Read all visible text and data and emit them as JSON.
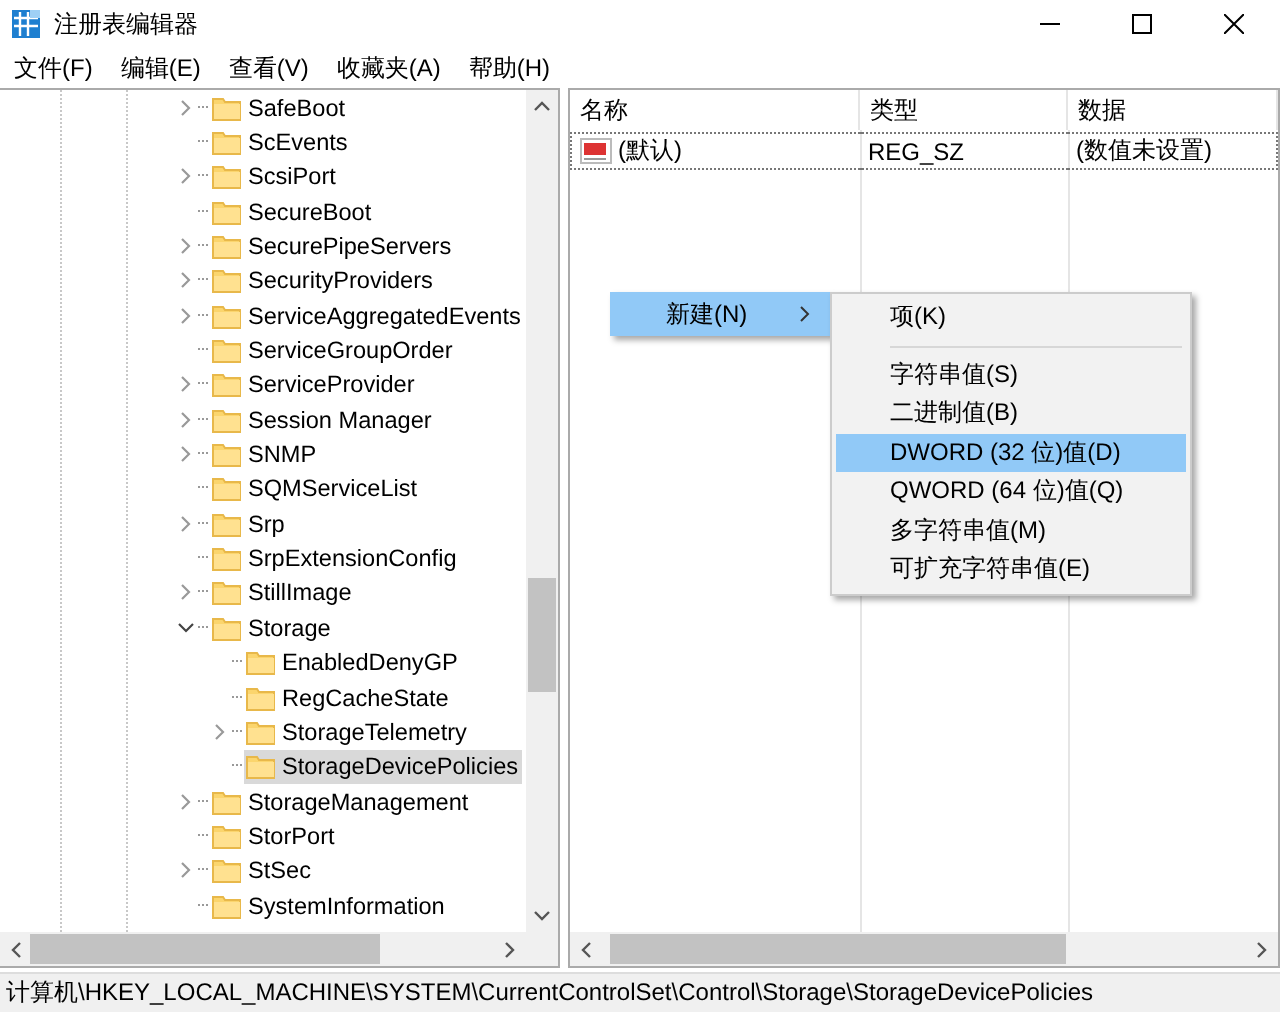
{
  "window": {
    "title": "注册表编辑器"
  },
  "menu": [
    {
      "label": "文件(F)"
    },
    {
      "label": "编辑(E)"
    },
    {
      "label": "查看(V)"
    },
    {
      "label": "收藏夹(A)"
    },
    {
      "label": "帮助(H)"
    }
  ],
  "tree": {
    "items": [
      {
        "kind": "branch",
        "label": "SafeBoot",
        "expanded": false,
        "selected": false
      },
      {
        "kind": "leaf",
        "label": "ScEvents",
        "selected": false
      },
      {
        "kind": "branch",
        "label": "ScsiPort",
        "expanded": false,
        "selected": false
      },
      {
        "kind": "leaf",
        "label": "SecureBoot",
        "selected": false
      },
      {
        "kind": "branch",
        "label": "SecurePipeServers",
        "expanded": false,
        "selected": false
      },
      {
        "kind": "branch",
        "label": "SecurityProviders",
        "expanded": false,
        "selected": false
      },
      {
        "kind": "branch",
        "label": "ServiceAggregatedEvents",
        "expanded": false,
        "selected": false
      },
      {
        "kind": "leaf",
        "label": "ServiceGroupOrder",
        "selected": false
      },
      {
        "kind": "branch",
        "label": "ServiceProvider",
        "expanded": false,
        "selected": false
      },
      {
        "kind": "branch",
        "label": "Session Manager",
        "expanded": false,
        "selected": false
      },
      {
        "kind": "branch",
        "label": "SNMP",
        "expanded": false,
        "selected": false
      },
      {
        "kind": "leaf",
        "label": "SQMServiceList",
        "selected": false
      },
      {
        "kind": "branch",
        "label": "Srp",
        "expanded": false,
        "selected": false
      },
      {
        "kind": "leaf",
        "label": "SrpExtensionConfig",
        "selected": false
      },
      {
        "kind": "branch",
        "label": "StillImage",
        "expanded": false,
        "selected": false
      },
      {
        "kind": "branch",
        "label": "Storage",
        "expanded": true,
        "selected": false,
        "children": [
          {
            "kind": "leaf",
            "label": "EnabledDenyGP",
            "selected": false
          },
          {
            "kind": "leaf",
            "label": "RegCacheState",
            "selected": false
          },
          {
            "kind": "branch",
            "label": "StorageTelemetry",
            "expanded": false,
            "selected": false
          },
          {
            "kind": "leaf",
            "label": "StorageDevicePolicies",
            "selected": true
          }
        ]
      },
      {
        "kind": "branch",
        "label": "StorageManagement",
        "expanded": false,
        "selected": false
      },
      {
        "kind": "leaf",
        "label": "StorPort",
        "selected": false
      },
      {
        "kind": "branch",
        "label": "StSec",
        "expanded": false,
        "selected": false
      },
      {
        "kind": "leaf",
        "label": "SystemInformation",
        "selected": false
      }
    ]
  },
  "values": {
    "columns": [
      "名称",
      "类型",
      "数据"
    ],
    "rows": [
      {
        "name": "(默认)",
        "type": "REG_SZ",
        "data": "(数值未设置)"
      }
    ]
  },
  "context_menu": {
    "items": [
      {
        "label": "新建(N)",
        "has_submenu": true,
        "selected": true
      }
    ],
    "submenu": [
      {
        "kind": "item",
        "label": "项(K)",
        "selected": false
      },
      {
        "kind": "separator"
      },
      {
        "kind": "item",
        "label": "字符串值(S)",
        "selected": false
      },
      {
        "kind": "item",
        "label": "二进制值(B)",
        "selected": false
      },
      {
        "kind": "item",
        "label": "DWORD (32 位)值(D)",
        "selected": true
      },
      {
        "kind": "item",
        "label": "QWORD (64 位)值(Q)",
        "selected": false
      },
      {
        "kind": "item",
        "label": "多字符串值(M)",
        "selected": false
      },
      {
        "kind": "item",
        "label": "可扩充字符串值(E)",
        "selected": false
      }
    ]
  },
  "status_bar": {
    "path": "计算机\\HKEY_LOCAL_MACHINE\\SYSTEM\\CurrentControlSet\\Control\\Storage\\StorageDevicePolicies"
  }
}
